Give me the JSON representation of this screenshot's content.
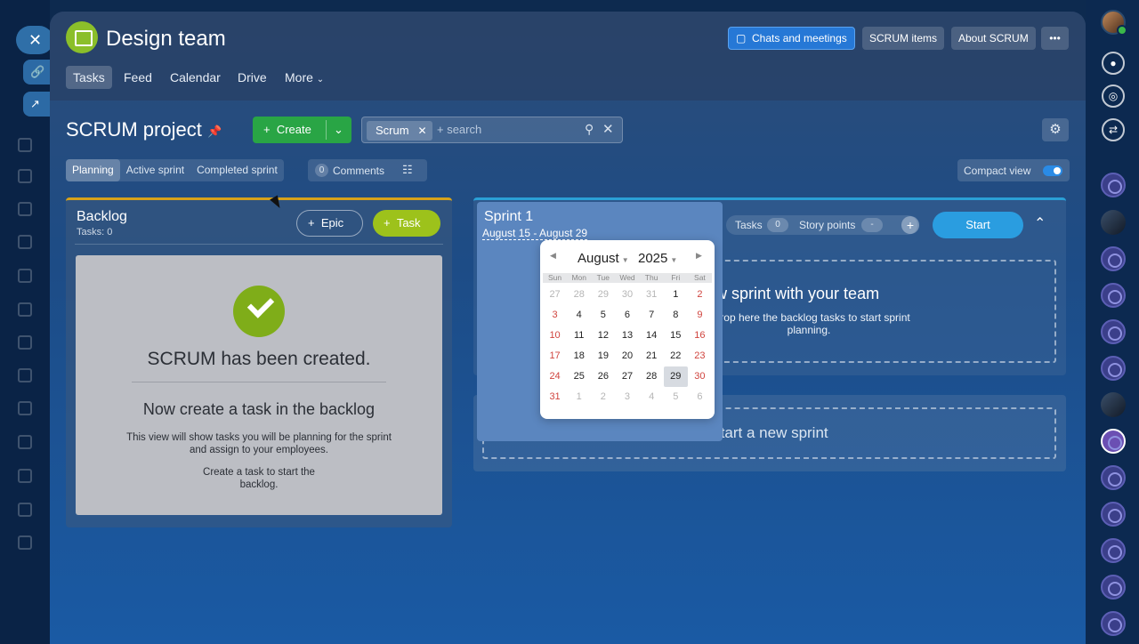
{
  "window": {
    "close_icon": "close-icon"
  },
  "header": {
    "team_name": "Design team",
    "buttons": {
      "chats": "Chats and meetings",
      "scrum_items": "SCRUM items",
      "about": "About SCRUM",
      "more": "•••"
    },
    "tabs": [
      "Tasks",
      "Feed",
      "Calendar",
      "Drive",
      "More"
    ],
    "active_tab": "Tasks"
  },
  "toolbar": {
    "project_title": "SCRUM project",
    "create_label": "Create",
    "search_chip": "Scrum",
    "search_placeholder": "+ search"
  },
  "view_tabs": [
    "Planning",
    "Active sprint",
    "Completed sprint"
  ],
  "comments": {
    "count": "0",
    "label": "Comments"
  },
  "compact_view": {
    "label": "Compact view",
    "enabled": true
  },
  "backlog": {
    "title": "Backlog",
    "subtitle": "Tasks: 0",
    "epic_label": "Epic",
    "task_label": "Task",
    "empty": {
      "title": "SCRUM has been created.",
      "subtitle": "Now create a task in the backlog",
      "desc1": "This view will show tasks you will be planning for the sprint and assign to your employees.",
      "desc2": "Create a task to start the backlog."
    }
  },
  "sprint": {
    "name": "Sprint 1",
    "dates": "August 15 - August 29",
    "tasks_label": "Tasks",
    "tasks_count": "0",
    "story_points_label": "Story points",
    "story_points_value": "-",
    "start_label": "Start",
    "dropzone_title": "ew sprint with your team",
    "dropzone_desc": "r drop here the backlog tasks to start sprint planning."
  },
  "new_sprint": {
    "label": "Start a new sprint"
  },
  "calendar": {
    "month": "August",
    "year": "2025",
    "weekdays": [
      "Sun",
      "Mon",
      "Tue",
      "Wed",
      "Thu",
      "Fri",
      "Sat"
    ],
    "weeks": [
      [
        "27",
        "28",
        "29",
        "30",
        "31",
        "1",
        "2"
      ],
      [
        "3",
        "4",
        "5",
        "6",
        "7",
        "8",
        "9"
      ],
      [
        "10",
        "11",
        "12",
        "13",
        "14",
        "15",
        "16"
      ],
      [
        "17",
        "18",
        "19",
        "20",
        "21",
        "22",
        "23"
      ],
      [
        "24",
        "25",
        "26",
        "27",
        "28",
        "29",
        "30"
      ],
      [
        "31",
        "1",
        "2",
        "3",
        "4",
        "5",
        "6"
      ]
    ],
    "selected": "29"
  }
}
